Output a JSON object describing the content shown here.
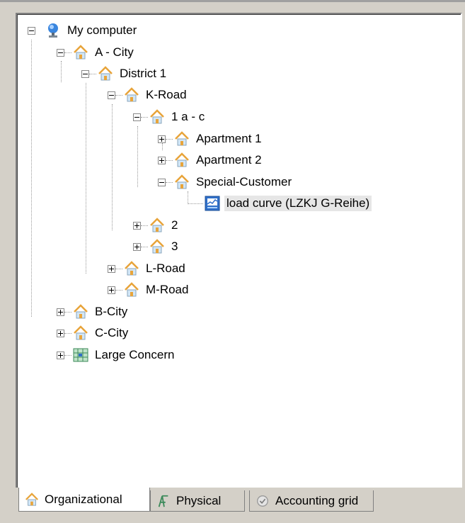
{
  "tree": {
    "my_computer": "My computer",
    "a_city": "A - City",
    "district_1": "District 1",
    "k_road": "K-Road",
    "one_a_c": "1 a - c",
    "apartment_1": "Apartment 1",
    "apartment_2": "Apartment 2",
    "special_customer": "Special-Customer",
    "load_curve": "load curve (LZKJ G-Reihe)",
    "two": "2",
    "three": "3",
    "l_road": "L-Road",
    "m_road": "M-Road",
    "b_city": "B-City",
    "c_city": "C-City",
    "large_concern": "Large Concern"
  },
  "tabs": {
    "organizational": "Organizational",
    "physical": "Physical",
    "accounting_grid": "Accounting grid"
  },
  "colors": {
    "house_roof": "#e8a43a",
    "house_body": "#d2e6f6",
    "computer": "#2f6fc9",
    "selection": "#e6e6e6"
  }
}
